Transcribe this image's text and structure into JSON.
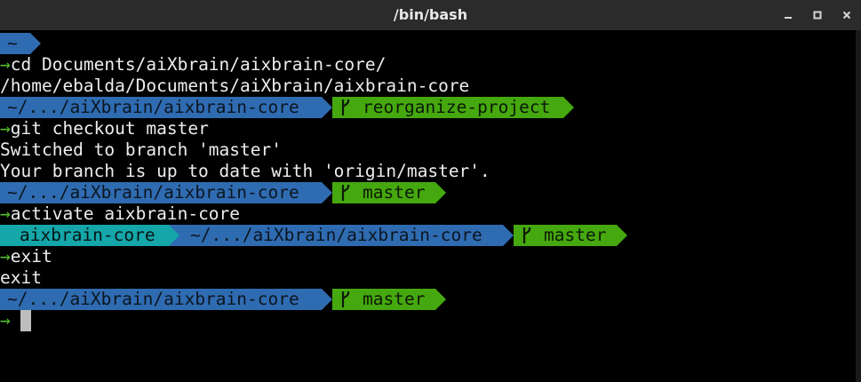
{
  "window": {
    "title": "/bin/bash"
  },
  "colors": {
    "dir": "#2f6bb1",
    "env": "#14a6a9",
    "git": "#45a80e",
    "arrow": "#4fbe2e",
    "text": "#ededed"
  },
  "terminal": {
    "prompt_symbol": "→",
    "home_dir": "~",
    "cmd1": "cd Documents/aiXbrain/aixbrain-core/",
    "out1": "/home/ebalda/Documents/aiXbrain/aixbrain-core",
    "dir": "~/.../aiXbrain/aixbrain-core",
    "branch1": "reorganize-project",
    "cmd2": "git checkout master",
    "out2": "Switched to branch 'master'",
    "out3": "Your branch is up to date with 'origin/master'.",
    "branch2": "master",
    "cmd3": "activate aixbrain-core",
    "env": "aixbrain-core",
    "cmd4": "exit",
    "out4": "exit"
  }
}
